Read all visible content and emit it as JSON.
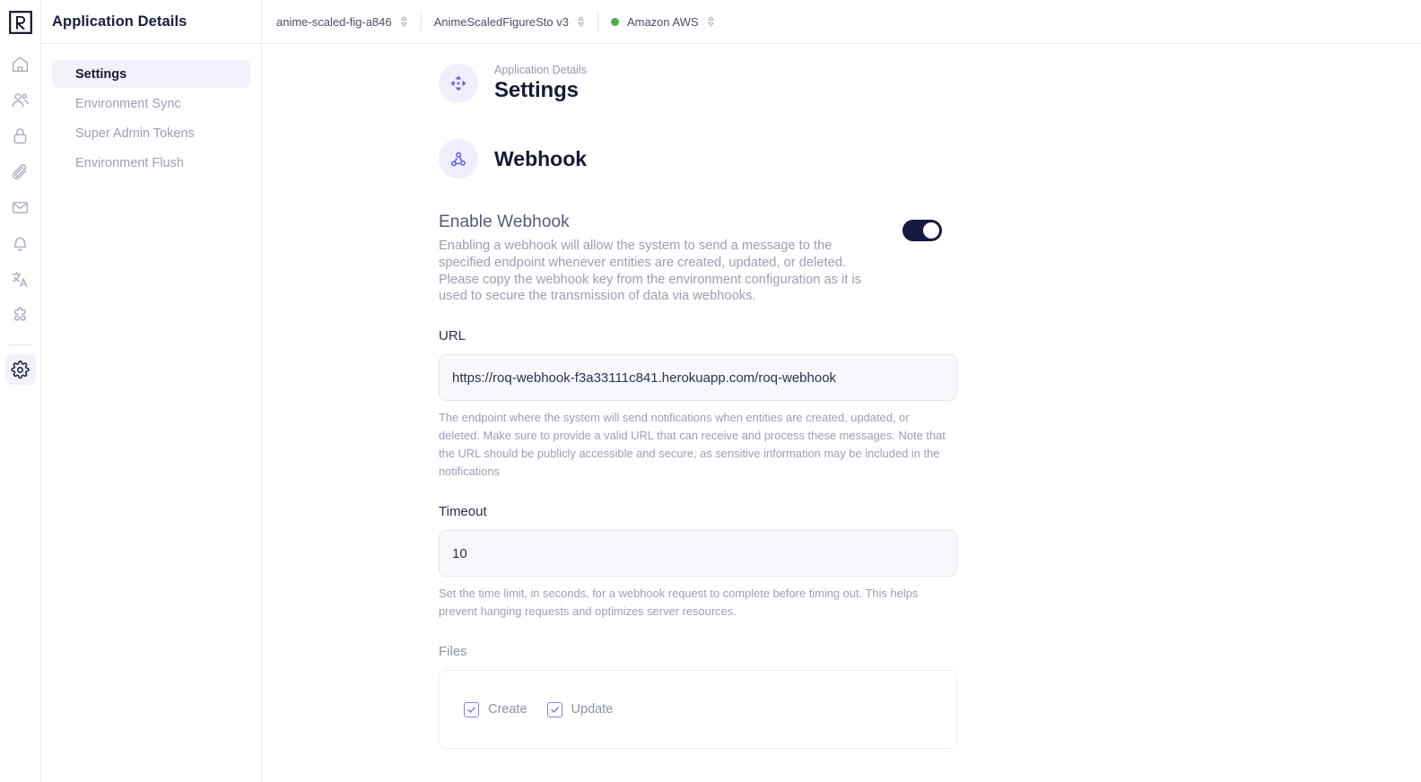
{
  "rail": {
    "logo": "roq-logo",
    "items": [
      {
        "icon": "home-icon",
        "name": "home",
        "active": false
      },
      {
        "icon": "users-icon",
        "name": "users",
        "active": false
      },
      {
        "icon": "lock-icon",
        "name": "lock",
        "active": false
      },
      {
        "icon": "paperclip-icon",
        "name": "files",
        "active": false
      },
      {
        "icon": "envelope-icon",
        "name": "mail",
        "active": false
      },
      {
        "icon": "bell-icon",
        "name": "notifications",
        "active": false
      },
      {
        "icon": "translate-icon",
        "name": "translations",
        "active": false
      },
      {
        "icon": "puzzle-icon",
        "name": "plugins",
        "active": false
      }
    ],
    "bottom_item": {
      "icon": "gear-icon",
      "name": "settings",
      "active": true
    }
  },
  "sidebar": {
    "title": "Application Details",
    "items": [
      {
        "label": "Settings",
        "active": true
      },
      {
        "label": "Environment Sync",
        "active": false
      },
      {
        "label": "Super Admin Tokens",
        "active": false
      },
      {
        "label": "Environment Flush",
        "active": false
      }
    ]
  },
  "topbar": {
    "crumbs": [
      {
        "label": "anime-scaled-fig-a846",
        "has_dot": false,
        "dot_color": ""
      },
      {
        "label": "AnimeScaledFigureSto v3",
        "has_dot": false,
        "dot_color": ""
      },
      {
        "label": "Amazon AWS",
        "has_dot": true,
        "dot_color": "#4caf50"
      }
    ]
  },
  "page": {
    "eyebrow": "Application Details",
    "title": "Settings",
    "title_icon": "move-icon",
    "section": {
      "icon": "webhook-icon",
      "title": "Webhook"
    },
    "enable": {
      "label": "Enable Webhook",
      "description": "Enabling a webhook will allow the system to send a message to the specified endpoint whenever entities are created, updated, or deleted. Please copy the webhook key from the environment configuration as it is used to secure the transmission of data via webhooks.",
      "toggle_on": true,
      "toggle_color": "#161a40"
    },
    "url_field": {
      "label": "URL",
      "value": "https://roq-webhook-f3a33111c841.herokuapp.com/roq-webhook",
      "help": "The endpoint where the system will send notifications when entities are created, updated, or deleted. Make sure to provide a valid URL that can receive and process these messages. Note that the URL should be publicly accessible and secure, as sensitive information may be included in the notifications"
    },
    "timeout_field": {
      "label": "Timeout",
      "value": "10",
      "help": "Set the time limit, in seconds, for a webhook request to complete before timing out. This helps prevent hanging requests and optimizes server resources."
    },
    "files": {
      "label": "Files",
      "options": [
        {
          "label": "Create",
          "checked": true
        },
        {
          "label": "Update",
          "checked": true
        }
      ]
    }
  },
  "colors": {
    "accent": "#6c63e8",
    "accent_bg": "#f0eefc",
    "dark": "#171a35",
    "muted": "#9aa0b3",
    "status_green": "#4caf50"
  }
}
